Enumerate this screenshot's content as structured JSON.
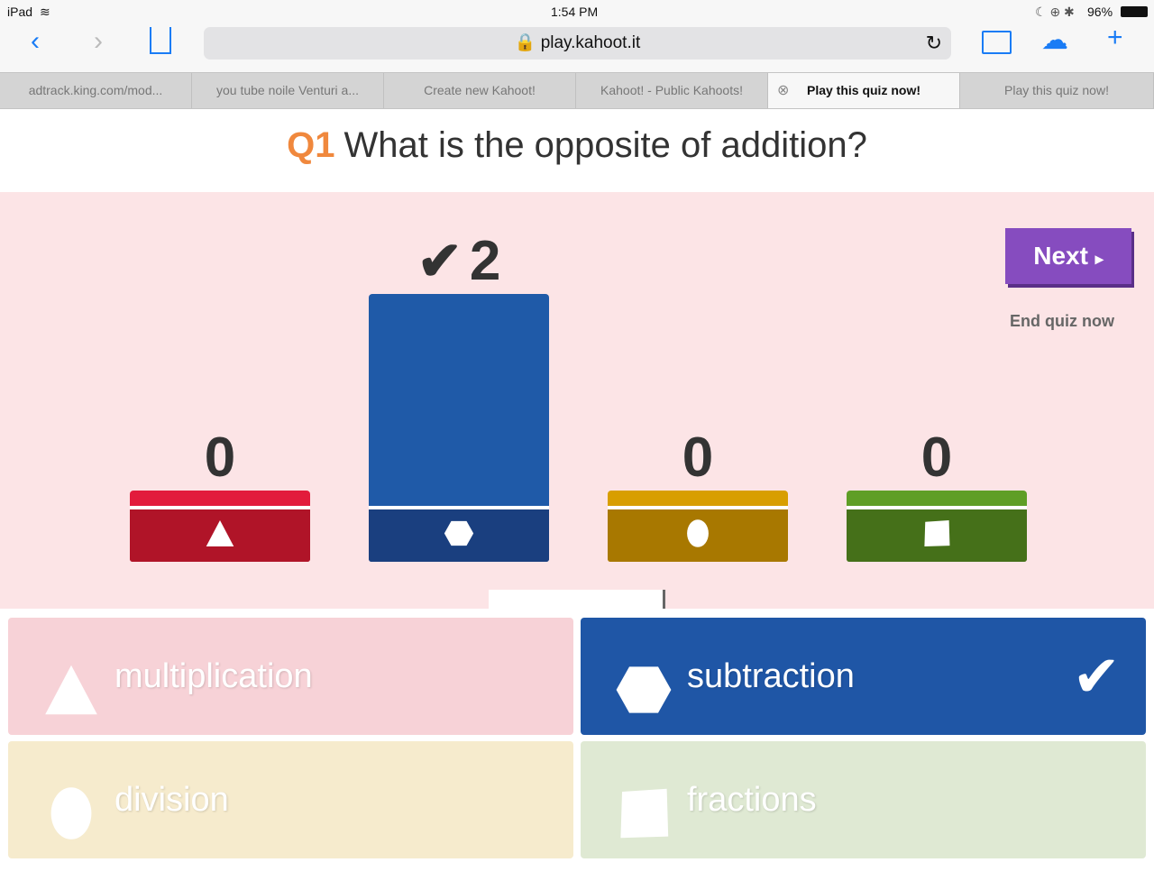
{
  "status_bar": {
    "device": "iPad",
    "time": "1:54 PM",
    "battery": "96%"
  },
  "browser": {
    "url": "play.kahoot.it",
    "tabs": [
      {
        "label": "adtrack.king.com/mod..."
      },
      {
        "label": "you tube noile Venturi a..."
      },
      {
        "label": "Create new Kahoot!"
      },
      {
        "label": "Kahoot! - Public Kahoots!"
      },
      {
        "label": "Play this quiz now!",
        "active": true
      },
      {
        "label": "Play this quiz now!"
      }
    ]
  },
  "question": {
    "number": "Q1",
    "text": "What is the opposite of addition?"
  },
  "results": [
    {
      "shape": "triangle",
      "count": 0,
      "color": "#e21b3c",
      "dark": "#b01428"
    },
    {
      "shape": "hexagon",
      "count": 2,
      "color": "#1f5aa8",
      "dark": "#1a3f7f",
      "correct": true
    },
    {
      "shape": "circle",
      "count": 0,
      "color": "#d89e00",
      "dark": "#a87800"
    },
    {
      "shape": "square",
      "count": 0,
      "color": "#5f9e26",
      "dark": "#457019"
    }
  ],
  "controls": {
    "next": "Next",
    "end_quiz": "End quiz now"
  },
  "answers": [
    {
      "label": "multiplication",
      "shape": "triangle",
      "bg": "#f7d2d7"
    },
    {
      "label": "subtraction",
      "shape": "hexagon",
      "bg": "#1f56a6",
      "correct": true
    },
    {
      "label": "division",
      "shape": "circle",
      "bg": "#f6ebcd"
    },
    {
      "label": "fractions",
      "shape": "square",
      "bg": "#dfe9d3"
    }
  ]
}
